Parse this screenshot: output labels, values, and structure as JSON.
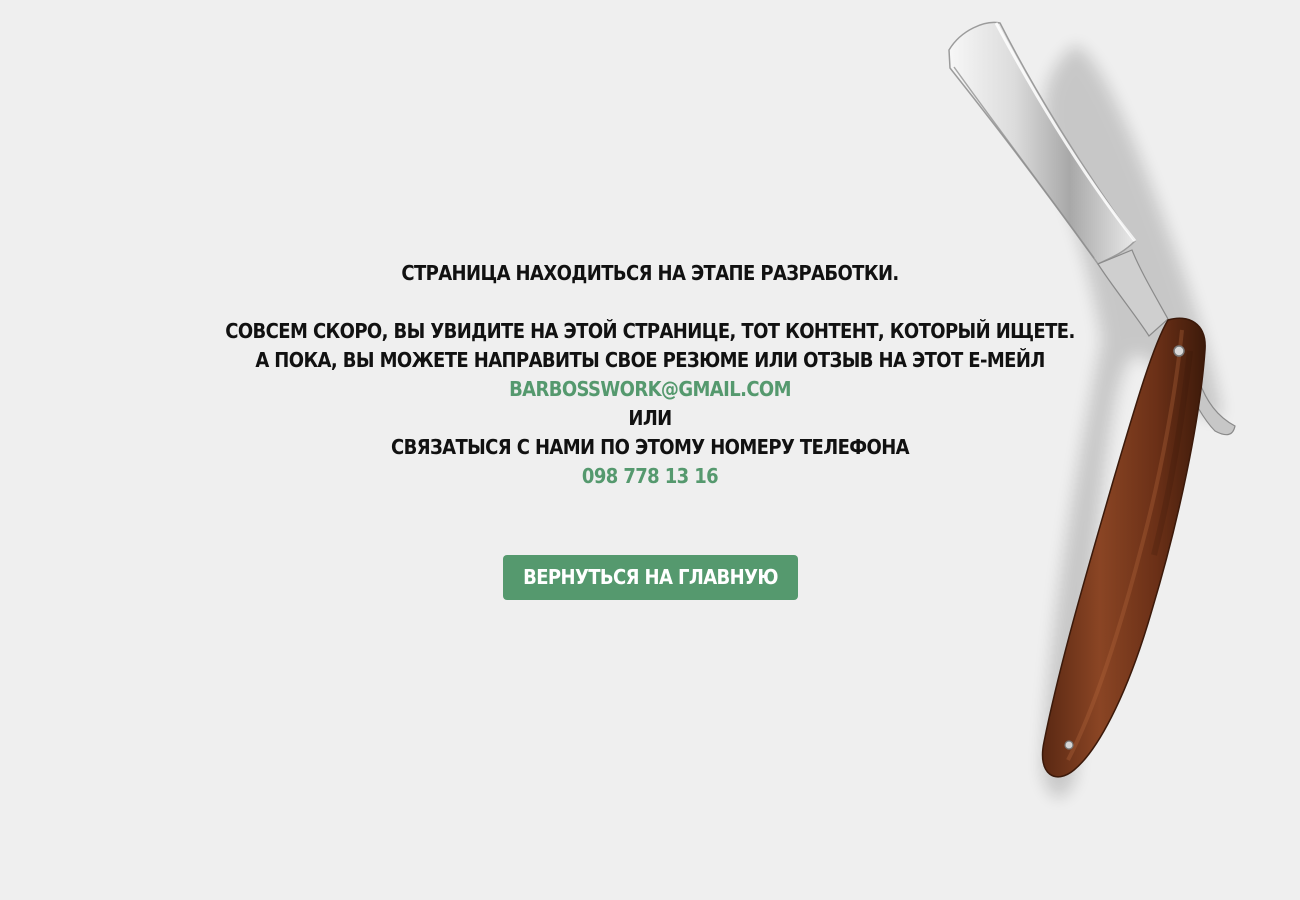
{
  "message": {
    "line1": "СТРАНИЦА НАХОДИТЬСЯ НА ЭТАПЕ РАЗРАБОТКИ.",
    "line2": "СОВСЕМ СКОРО, ВЫ УВИДИТЕ НА ЭТОЙ СТРАНИЦЕ, ТОТ КОНТЕНТ, КОТОРЫЙ ИЩЕТЕ.",
    "line3": "А ПОКА, ВЫ МОЖЕТЕ НАПРАВИТЫ СВОЕ РЕЗЮМЕ ИЛИ ОТЗЫВ НА ЭТОТ Е-МЕЙЛ",
    "email": "BARBOSSWORK@GMAIL.COM",
    "or": "ИЛИ",
    "phone_prompt": "СВЯЗАТЫСЯ С НАМИ ПО ЭТОМУ НОМЕРУ ТЕЛЕФОНА",
    "phone": "098 778 13 16"
  },
  "button": {
    "label": "ВЕРНУТЬСЯ НА ГЛАВНУЮ"
  },
  "colors": {
    "background": "#efefef",
    "text": "#111111",
    "accent": "#55996e",
    "button_text": "#ffffff"
  },
  "illustration": {
    "name": "straight-razor"
  }
}
